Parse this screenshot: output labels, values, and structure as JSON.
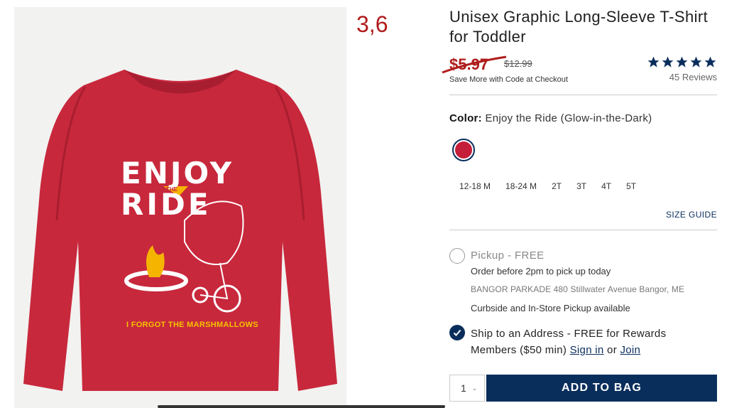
{
  "annotation": "3,6",
  "product": {
    "title": "Unisex Graphic Long-Sleeve T-Shirt for Toddler",
    "price_current": "$5.97",
    "price_original": "$12.99",
    "promo_text": "Save More with Code at Checkout",
    "rating": 5,
    "reviews": "45 Reviews"
  },
  "shirt_graphic": {
    "line1": "ENJOY",
    "line2": "RIDE",
    "pennant": "THE",
    "tagline": "I FORGOT THE MARSHMALLOWS"
  },
  "color": {
    "label": "Color:",
    "value": "Enjoy the Ride (Glow-in-the-Dark)",
    "swatch_hex": "#c41e3a"
  },
  "sizes": [
    "12-18 M",
    "18-24 M",
    "2T",
    "3T",
    "4T",
    "5T"
  ],
  "size_guide": "SIZE GUIDE",
  "pickup": {
    "title": "Pickup - FREE",
    "deadline": "Order before 2pm to pick up today",
    "address": "BANGOR PARKADE 480 Stillwater Avenue  Bangor, ME",
    "note": "Curbside and In-Store Pickup available"
  },
  "shipping": {
    "text1": "Ship to an Address - FREE for Rewards Members ($50 min)",
    "sign_in": "Sign in",
    "or": "or",
    "join": "Join"
  },
  "quantity": "1",
  "add_to_bag": "ADD TO BAG",
  "colors": {
    "brand_navy": "#0a2e5c",
    "sale_red": "#b01c1c"
  }
}
